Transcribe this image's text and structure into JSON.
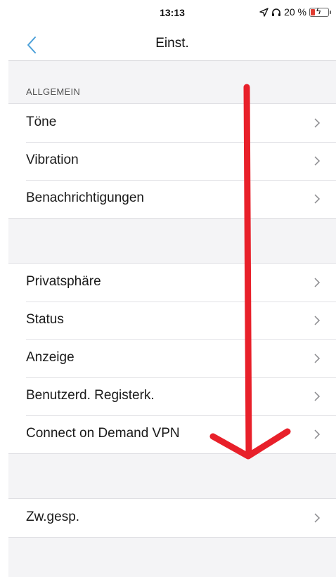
{
  "status_bar": {
    "time": "13:13",
    "battery": "20 %",
    "battery_level_percent": 20
  },
  "nav": {
    "title": "Einst."
  },
  "sections": [
    {
      "header": "ALLGEMEIN",
      "items": [
        {
          "label": "Töne"
        },
        {
          "label": "Vibration"
        },
        {
          "label": "Benachrichtigungen"
        }
      ]
    },
    {
      "header": "",
      "items": [
        {
          "label": "Privatsphäre"
        },
        {
          "label": "Status"
        },
        {
          "label": "Anzeige"
        },
        {
          "label": "Benutzerd. Registerk."
        },
        {
          "label": "Connect on Demand VPN"
        }
      ]
    },
    {
      "header": "",
      "items": [
        {
          "label": "Zw.gesp."
        }
      ]
    }
  ],
  "colors": {
    "accent": "#4a9fd8",
    "annotation_arrow": "#e8202a",
    "background": "#f4f4f6"
  },
  "icons": {
    "back": "chevron-left-icon",
    "row": "chevron-right-icon",
    "location": "location-arrow-icon",
    "headphones": "headphones-icon"
  }
}
